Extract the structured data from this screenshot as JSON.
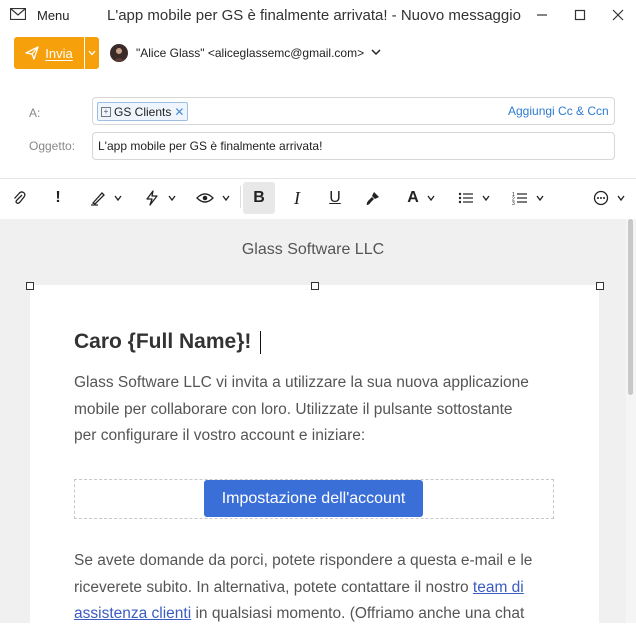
{
  "window": {
    "menu_label": "Menu",
    "title": "L'app mobile per GS è finalmente arrivata! - Nuovo messaggio"
  },
  "toolbar": {
    "send_label": "Invia",
    "from": "\"Alice Glass\" <aliceglassemc@gmail.com>"
  },
  "fields": {
    "to_label": "A:",
    "to_chip": "GS Clients",
    "cc_link": "Aggiungi Cc & Ccn",
    "subject_label": "Oggetto:",
    "subject_value": "L'app mobile per GS è finalmente arrivata!"
  },
  "body": {
    "company": "Glass Software LLC",
    "greeting": "Caro {Full Name}!",
    "para1_lines": [
      "Glass Software LLC vi invita a utilizzare la sua nuova applicazione",
      "mobile per collaborare con loro. Utilizzate il pulsante sottostante",
      "per configurare il vostro account e iniziare:"
    ],
    "cta_label": "Impostazione dell'account",
    "para2_line1": "Se avete domande da porci, potete rispondere a questa e-mail e le",
    "para2_line2_a": "riceverete subito. In alternativa, potete contattare il nostro ",
    "para2_link_a": "team di",
    "para2_link_b": "assistenza clienti",
    "para2_line3_b": " in qualsiasi momento. (Offriamo anche una chat"
  },
  "icons": {
    "mail": "mail-icon",
    "send": "paper-plane-icon",
    "attach": "paperclip-icon",
    "important": "exclamation-icon",
    "signature": "pen-icon",
    "priority": "lightning-icon",
    "read_receipt": "eye-icon",
    "bold": "bold-icon",
    "italic": "italic-icon",
    "underline": "underline-icon",
    "format_painter": "brush-icon",
    "font_color": "font-color-icon",
    "bullets": "bullet-list-icon",
    "numbered": "numbered-list-icon",
    "more": "more-icon"
  },
  "colors": {
    "accent": "#f6a00c",
    "link": "#2f7bd1",
    "cta": "#3b6fd8"
  },
  "formatting": {
    "bold_label": "B",
    "italic_label": "I",
    "underline_label": "U",
    "font_label": "A"
  }
}
